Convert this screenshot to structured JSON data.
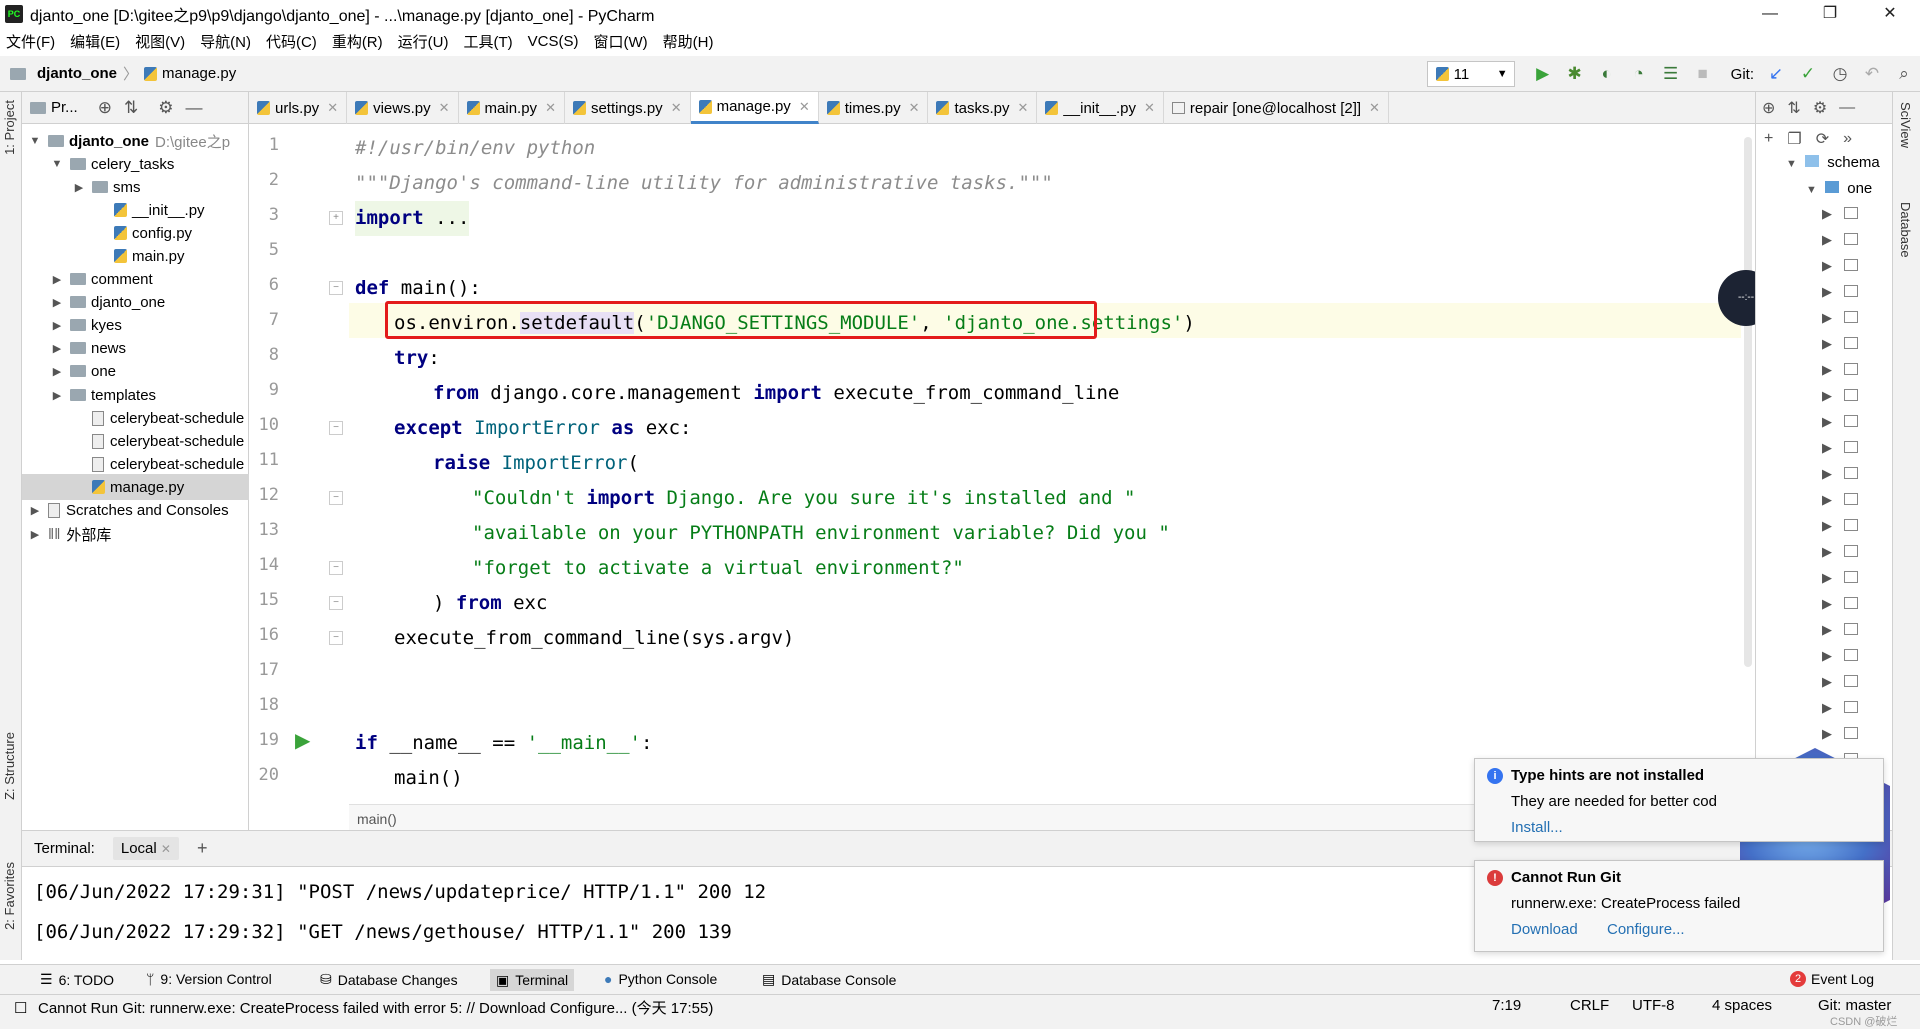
{
  "window": {
    "title": "djanto_one [D:\\gitee之p9\\p9\\django\\djanto_one] - ...\\manage.py [djanto_one] - PyCharm",
    "app_icon": "PC"
  },
  "menu": [
    "文件(F)",
    "编辑(E)",
    "视图(V)",
    "导航(N)",
    "代码(C)",
    "重构(R)",
    "运行(U)",
    "工具(T)",
    "VCS(S)",
    "窗口(W)",
    "帮助(H)"
  ],
  "breadcrumb": {
    "project": "djanto_one",
    "file": "manage.py"
  },
  "toolbar": {
    "run_config": "11",
    "git_label": "Git:"
  },
  "project_panel": {
    "title": "Pr...",
    "tree": [
      {
        "label": "djanto_one",
        "extra": "D:\\gitee之p",
        "type": "folder",
        "depth": 0,
        "expanded": true
      },
      {
        "label": "celery_tasks",
        "type": "folder",
        "depth": 1,
        "expanded": true
      },
      {
        "label": "sms",
        "type": "folder",
        "depth": 2,
        "expanded": false
      },
      {
        "label": "__init__.py",
        "type": "py",
        "depth": 3
      },
      {
        "label": "config.py",
        "type": "py",
        "depth": 3
      },
      {
        "label": "main.py",
        "type": "py",
        "depth": 3
      },
      {
        "label": "comment",
        "type": "folder",
        "depth": 1,
        "expanded": false
      },
      {
        "label": "djanto_one",
        "type": "folder",
        "depth": 1,
        "expanded": false
      },
      {
        "label": "kyes",
        "type": "folder",
        "depth": 1,
        "expanded": false
      },
      {
        "label": "news",
        "type": "folder",
        "depth": 1,
        "expanded": false
      },
      {
        "label": "one",
        "type": "folder",
        "depth": 1,
        "expanded": false
      },
      {
        "label": "templates",
        "type": "folder",
        "depth": 1,
        "expanded": false
      },
      {
        "label": "celerybeat-schedule",
        "type": "file",
        "depth": 2
      },
      {
        "label": "celerybeat-schedule",
        "type": "file",
        "depth": 2
      },
      {
        "label": "celerybeat-schedule",
        "type": "file",
        "depth": 2
      },
      {
        "label": "manage.py",
        "type": "py",
        "depth": 2,
        "selected": true
      },
      {
        "label": "Scratches and Consoles",
        "type": "scratch",
        "depth": 0,
        "expanded": false
      },
      {
        "label": "外部库",
        "type": "lib",
        "depth": 0,
        "expanded": false
      }
    ]
  },
  "tabs": [
    {
      "label": "urls.py"
    },
    {
      "label": "views.py"
    },
    {
      "label": "main.py"
    },
    {
      "label": "settings.py"
    },
    {
      "label": "manage.py",
      "active": true
    },
    {
      "label": "times.py"
    },
    {
      "label": "tasks.py"
    },
    {
      "label": "__init__.py"
    },
    {
      "label": "repair [one@localhost [2]]",
      "db": true
    }
  ],
  "code": {
    "line_numbers": [
      "1",
      "2",
      "3",
      "5",
      "6",
      "7",
      "8",
      "9",
      "10",
      "11",
      "12",
      "13",
      "14",
      "15",
      "16",
      "17",
      "18",
      "19",
      "20"
    ],
    "lines": [
      "#!/usr/bin/env python",
      "\"\"\"Django's command-line utility for administrative tasks.\"\"\"",
      "import ...",
      "",
      "def main():",
      "os.environ.setdefault('DJANGO_SETTINGS_MODULE', 'djanto_one.settings')",
      "try:",
      "from django.core.management import execute_from_command_line",
      "except ImportError as exc:",
      "raise ImportError(",
      "\"Couldn't import Django. Are you sure it's installed and \"",
      "\"available on your PYTHONPATH environment variable? Did you \"",
      "\"forget to activate a virtual environment?\"",
      ") from exc",
      "execute_from_command_line(sys.argv)",
      "",
      "",
      "if __name__ == '__main__':",
      "main()"
    ],
    "context_breadcrumb": "main()"
  },
  "db_panel": {
    "items": [
      "schema",
      "one"
    ]
  },
  "terminal": {
    "label": "Terminal:",
    "tab": "Local",
    "lines": [
      "[06/Jun/2022 17:29:31] \"POST /news/updateprice/ HTTP/1.1\" 200 12",
      "[06/Jun/2022 17:29:32] \"GET /news/gethouse/ HTTP/1.1\" 200 139"
    ]
  },
  "notifications": [
    {
      "title": "Type hints are not installed",
      "body": "They are needed for better cod",
      "links": [
        "Install..."
      ],
      "kind": "info"
    },
    {
      "title": "Cannot Run Git",
      "body": "runnerw.exe: CreateProcess failed",
      "links": [
        "Download",
        "Configure..."
      ],
      "kind": "error"
    }
  ],
  "tool_windows": [
    "6: TODO",
    "9: Version Control",
    "Database Changes",
    "Terminal",
    "Python Console",
    "Database Console"
  ],
  "event_log": {
    "label": "Event Log",
    "count": "2"
  },
  "status": {
    "message": "Cannot Run Git: runnerw.exe: CreateProcess failed with error 5: // Download Configure... (今天 17:55)",
    "position": "7:19",
    "line_sep": "CRLF",
    "encoding": "UTF-8",
    "indent": "4 spaces",
    "branch": "Git: master",
    "watermark": "CSDN @破烂"
  },
  "side_tabs": {
    "left": [
      "1: Project",
      "Z: Structure",
      "2: Favorites"
    ],
    "right": [
      "SciView",
      "Database"
    ]
  }
}
